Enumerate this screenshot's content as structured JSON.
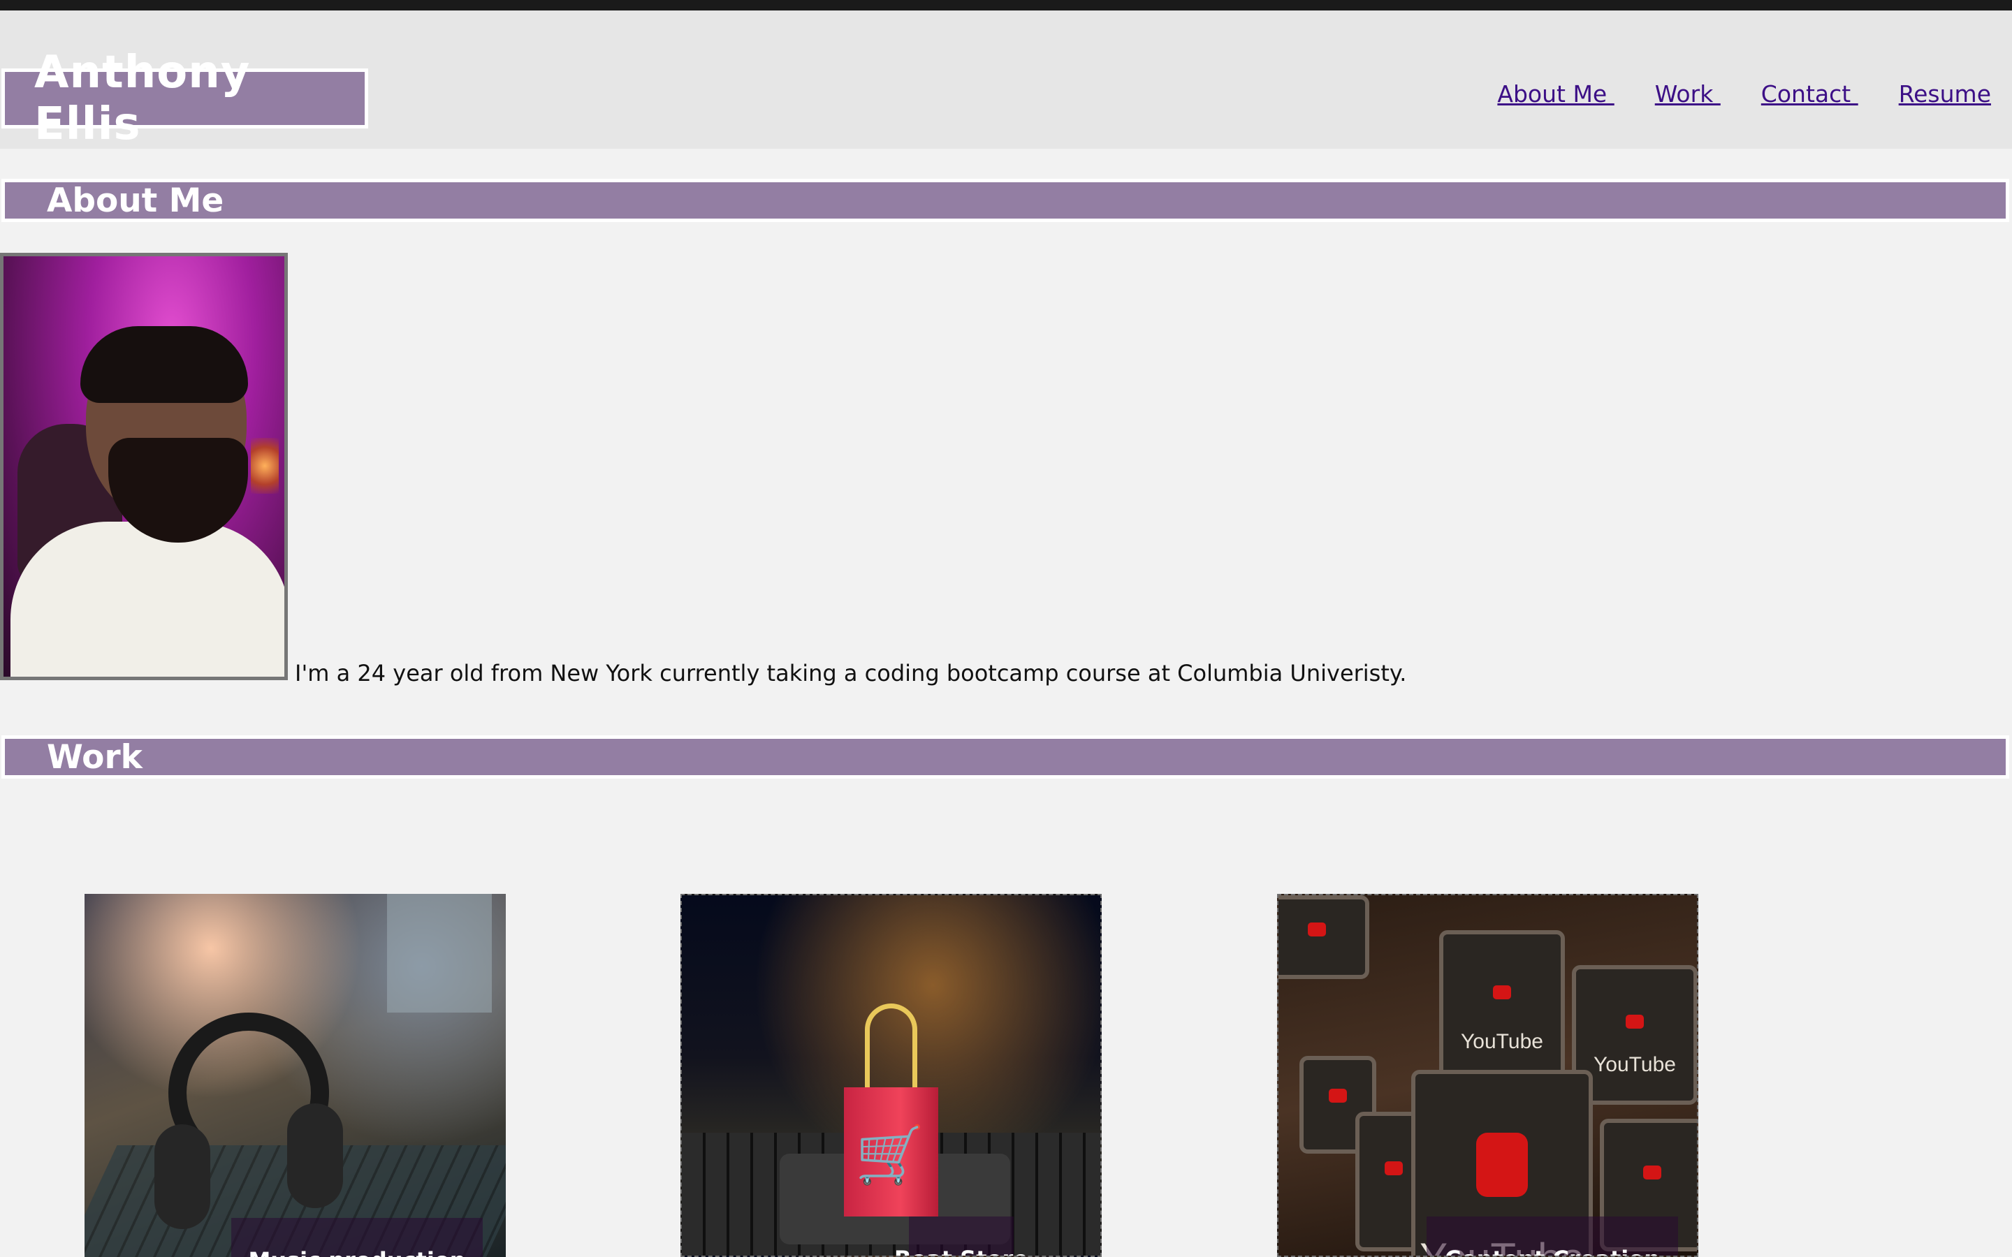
{
  "header": {
    "brand": "Anthony Ellis",
    "nav": [
      "About Me ",
      "Work ",
      "Contact ",
      "Resume"
    ]
  },
  "about": {
    "heading": "About Me",
    "text": "I'm a 24 year old from New York currently taking a coding bootcamp course at Columbia Univeristy."
  },
  "work": {
    "heading": "Work",
    "cards": [
      {
        "caption": "Music production"
      },
      {
        "caption": "Beat Store"
      },
      {
        "caption": "Content Creation"
      }
    ]
  },
  "decor": {
    "youtube_label": "YouTube",
    "cart_glyph": "🛒"
  },
  "colors": {
    "accent": "#937ea3",
    "link": "#3c0f86",
    "header_bg": "#e6e6e6",
    "page_bg": "#f2f2f2"
  }
}
